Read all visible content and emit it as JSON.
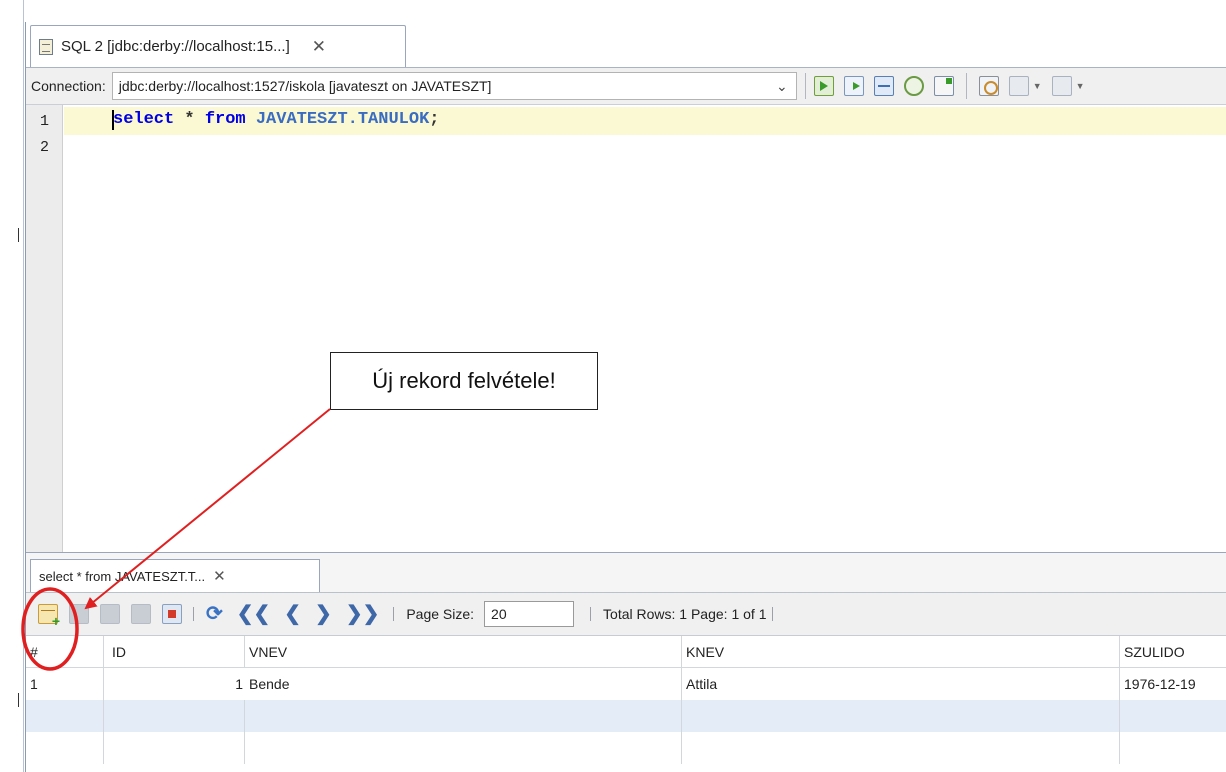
{
  "editor": {
    "tab": {
      "title": "SQL 2 [jdbc:derby://localhost:15...]",
      "close": "✕"
    },
    "connection": {
      "label": "Connection:",
      "value": "jdbc:derby://localhost:1527/iskola [javateszt on JAVATESZT]"
    },
    "toolbar_icons": [
      "run-sql-icon",
      "run-statement-icon",
      "explain-icon",
      "sql-history-icon",
      "new-sql-icon",
      "select-in-projects-icon",
      "previous-icon",
      "next-icon"
    ],
    "line_numbers": [
      "1",
      "2"
    ],
    "code": {
      "kw_select": "select",
      "star": " * ",
      "kw_from": "from",
      "table": " JAVATESZT.TANULOK",
      "end": ";"
    }
  },
  "results": {
    "tab": {
      "title": "select * from JAVATESZT.T...",
      "close": "✕"
    },
    "toolbar": {
      "page_size_label": "Page Size:",
      "page_size_value": "20",
      "status": "Total Rows: 1  Page: 1 of 1"
    },
    "columns": [
      "#",
      "ID",
      "VNEV",
      "KNEV",
      "SZULIDO"
    ],
    "rows": [
      {
        "num": "1",
        "id": "1",
        "vnev": "Bende",
        "knev": "Attila",
        "szulido": "1976-12-19"
      }
    ]
  },
  "annotation": {
    "callout_text": "Új rekord felvétele!",
    "color": "#e02020"
  }
}
